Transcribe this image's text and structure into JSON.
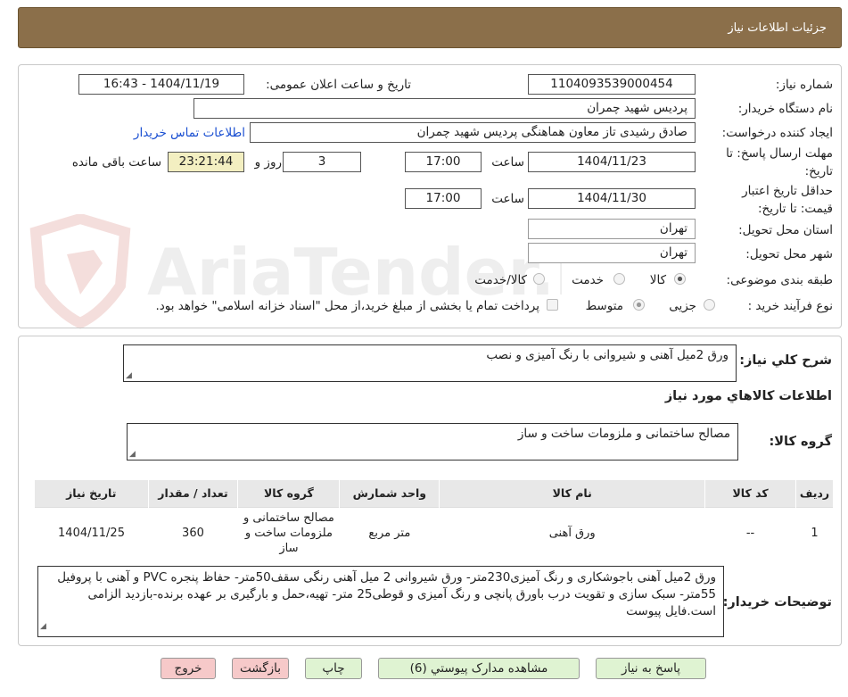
{
  "header": {
    "title": "جزئیات اطلاعات نیاز"
  },
  "watermark": {
    "text": "AriaTender.neT"
  },
  "fields": {
    "need_number": {
      "label": "شماره نیاز:",
      "value": "1104093539000454"
    },
    "announce": {
      "label": "تاریخ و ساعت اعلان عمومی:",
      "value": "1404/11/19 - 16:43"
    },
    "buyer_org": {
      "label": "نام دستگاه خریدار:",
      "value": "پردیس شهید چمران"
    },
    "requester": {
      "label": "ایجاد کننده درخواست:",
      "value": "صادق رشیدی تاز معاون هماهنگی  پردیس شهید چمران",
      "contact_link": "اطلاعات تماس خریدار"
    },
    "deadline": {
      "label_line1": "مهلت ارسال پاسخ: تا",
      "label_line2": "تاریخ:",
      "date": "1404/11/23",
      "time_label": "ساعت",
      "time": "17:00",
      "days": "3",
      "days_label": "روز و",
      "remaining": "23:21:44",
      "remaining_label": "ساعت باقی مانده"
    },
    "validity": {
      "label_line1": "حداقل تاریخ اعتبار",
      "label_line2": "قیمت: تا تاریخ:",
      "date": "1404/11/30",
      "time_label": "ساعت",
      "time": "17:00"
    },
    "province": {
      "label": "استان محل تحویل:",
      "value": "تهران"
    },
    "city": {
      "label": "شهر محل تحویل:",
      "value": "تهران"
    },
    "category": {
      "label": "طبقه بندی موضوعی:",
      "options": [
        "کالا",
        "خدمت",
        "کالا/خدمت"
      ],
      "selected": "کالا"
    },
    "process": {
      "label": "نوع فرآیند خرید :",
      "options": [
        "جزیی",
        "متوسط"
      ],
      "selected": "متوسط",
      "note": "پرداخت تمام یا بخشی از مبلغ خرید،از محل \"اسناد خزانه اسلامی\" خواهد بود."
    }
  },
  "summary": {
    "label": "شرح کلي نياز:",
    "value": "ورق 2میل آهنی و شیروانی با رنگ آمیزی و نصب"
  },
  "goods_section_title": "اطلاعات کالاهاي مورد نياز",
  "goods_group": {
    "label": "گروه کالا:",
    "value": "مصالح ساختمانی و ملزومات ساخت و ساز"
  },
  "table": {
    "headers": [
      "رديف",
      "کد کالا",
      "نام کالا",
      "واحد شمارش",
      "گروه کالا",
      "تعداد / مقدار",
      "تاريخ نياز"
    ],
    "rows": [
      [
        "1",
        "--",
        "ورق آهنی",
        "متر مربع",
        "مصالح ساختمانی و ملزومات ساخت و ساز",
        "360",
        "1404/11/25"
      ]
    ]
  },
  "buyer_notes": {
    "label": "توضیحات خریدار:",
    "value": "ورق 2میل آهنی باجوشکاری و رنگ آمیزی230متر- ورق شیروانی 2 میل آهنی رنگی سقف50متر- حفاظ پنجره PVC و آهنی با پروفیل 55متر- سبک سازی و تقویت درب باورق پانچی و رنگ آمیزی و قوطی25 متر- تهیه،حمل و بارگیری بر عهده برنده-بازدید الزامی است.فایل پیوست"
  },
  "buttons": {
    "reply": "پاسخ به نیاز",
    "docs": "مشاهده مدارک پیوستي (6)",
    "print": "چاپ",
    "back": "بازگشت",
    "exit": "خروج"
  }
}
